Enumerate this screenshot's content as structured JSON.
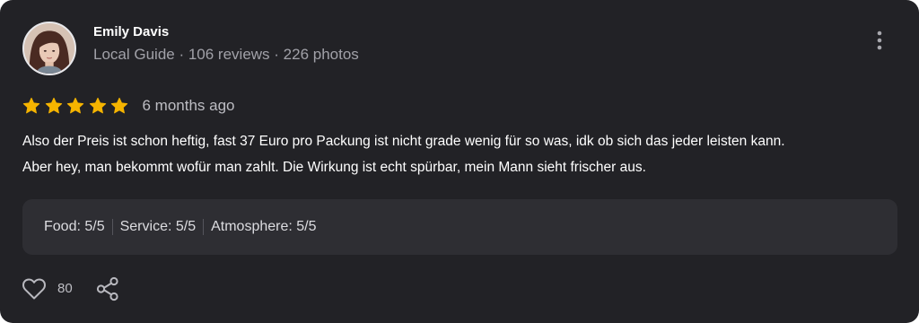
{
  "review": {
    "author": {
      "name": "Emily Davis",
      "meta": "Local Guide · 106 reviews · 226 photos"
    },
    "rating": {
      "stars": 5,
      "max": 5
    },
    "date": "6 months ago",
    "text_lines": [
      "Also der Preis ist schon heftig, fast 37 Euro pro Packung ist nicht grade wenig für so was, idk ob sich das jeder leisten kann.",
      "Aber hey, man bekommt wofür man zahlt. Die Wirkung ist echt spürbar, mein Mann sieht frischer aus."
    ],
    "aspects": [
      {
        "label": "Food: 5/5"
      },
      {
        "label": "Service: 5/5"
      },
      {
        "label": "Atmosphere: 5/5"
      }
    ],
    "likes": "80"
  },
  "icons": {
    "more": "more-vertical-icon",
    "star": "star-icon",
    "like": "heart-outline-icon",
    "share": "share-icon"
  },
  "colors": {
    "card_background": "#222226",
    "aspects_background": "#2e2e33",
    "star": "#f5b400",
    "secondary_text": "#a1a1a8"
  }
}
